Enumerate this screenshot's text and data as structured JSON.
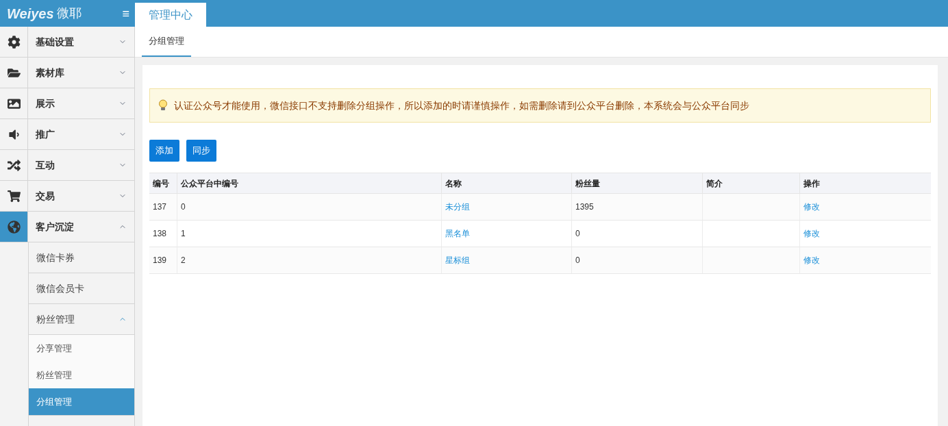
{
  "header": {
    "logo_text": "Weiyes",
    "logo_cn": "微耶",
    "menu_icon": "≡",
    "tabs": [
      {
        "label": "管理中心",
        "selected": true
      }
    ]
  },
  "sidebar": {
    "items": [
      {
        "label": "基础设置",
        "expanded": false,
        "selected": false
      },
      {
        "label": "素材库",
        "expanded": false,
        "selected": false
      },
      {
        "label": "展示",
        "expanded": false,
        "selected": false
      },
      {
        "label": "推广",
        "expanded": false,
        "selected": false
      },
      {
        "label": "互动",
        "expanded": false,
        "selected": false
      },
      {
        "label": "交易",
        "expanded": false,
        "selected": false
      },
      {
        "label": "客户沉淀",
        "expanded": true,
        "selected": true,
        "children": [
          {
            "label": "微信卡券",
            "selected": false
          },
          {
            "label": "微信会员卡",
            "selected": false
          },
          {
            "label": "粉丝管理",
            "expanded": true,
            "selected": false,
            "children": [
              {
                "label": "分享管理",
                "selected": false
              },
              {
                "label": "粉丝管理",
                "selected": false
              },
              {
                "label": "分组管理",
                "selected": true
              }
            ]
          }
        ]
      }
    ]
  },
  "subtabs": [
    {
      "label": "分组管理",
      "selected": true
    }
  ],
  "notice": "认证公众号才能使用，微信接口不支持删除分组操作，所以添加的时请谨慎操作，如需删除请到公众平台删除，本系统会与公众平台同步",
  "buttons": [
    "添加",
    "同步"
  ],
  "table": {
    "columns": [
      "编号",
      "公众平台中编号",
      "名称",
      "粉丝量",
      "简介",
      "操作"
    ],
    "rows": [
      [
        "137",
        "0",
        "未分组",
        "1395",
        "",
        "修改"
      ],
      [
        "138",
        "1",
        "黑名单",
        "0",
        "",
        "修改"
      ],
      [
        "139",
        "2",
        "星标组",
        "0",
        "",
        "修改"
      ]
    ]
  }
}
